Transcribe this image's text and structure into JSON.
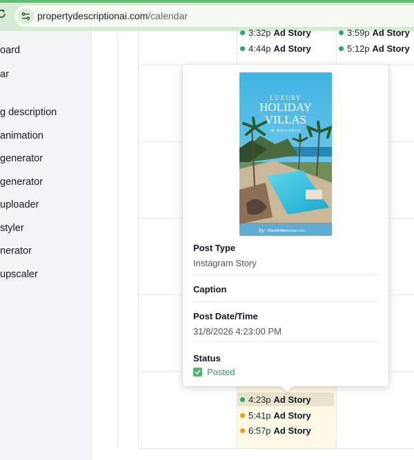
{
  "browser": {
    "url_domain": "propertydescriptionai.com",
    "url_path": "/calendar"
  },
  "sidebar": {
    "items": [
      {
        "label": "oard"
      },
      {
        "label": "ar"
      },
      {
        "label": "g description"
      },
      {
        "label": " animation"
      },
      {
        "label": " generator"
      },
      {
        "label": " generator"
      },
      {
        "label": " uploader"
      },
      {
        "label": " styler"
      },
      {
        "label": "nerator"
      },
      {
        "label": " upscaler"
      }
    ]
  },
  "calendar": {
    "top_events_left": [
      {
        "time": "3:32p",
        "title": "Ad Story",
        "status_color": "#22a867"
      },
      {
        "time": "4:44p",
        "title": "Ad Story",
        "status_color": "#22a867"
      }
    ],
    "top_events_right": [
      {
        "time": "3:59p",
        "title": "Ad Story",
        "status_color": "#22a867"
      },
      {
        "time": "5:12p",
        "title": "Ad Story",
        "status_color": "#22a867"
      }
    ],
    "today_events": [
      {
        "time": "4:23p",
        "title": "Ad Story",
        "status_color": "#22a867"
      },
      {
        "time": "5:41p",
        "title": "Ad Story",
        "status_color": "#f59e0b"
      },
      {
        "time": "6:57p",
        "title": "Ad Story",
        "status_color": "#f59e0b"
      }
    ]
  },
  "popover": {
    "image": {
      "line1": "LUXURY",
      "line2": "HOLIDAY",
      "line3": "VILLAS",
      "line4": "IN MALLORCA",
      "signature": "by",
      "brand": "VillasMediterranean.com"
    },
    "post_type_label": "Post Type",
    "post_type_value": "Instagram Story",
    "caption_label": "Caption",
    "post_datetime_label": "Post Date/Time",
    "post_datetime_value": "31/8/2026 4:23:00 PM",
    "status_label": "Status",
    "status_value": "Posted"
  },
  "colors": {
    "posted": "#22a867",
    "scheduled": "#f59e0b",
    "today_cell": "#fef9e5"
  }
}
